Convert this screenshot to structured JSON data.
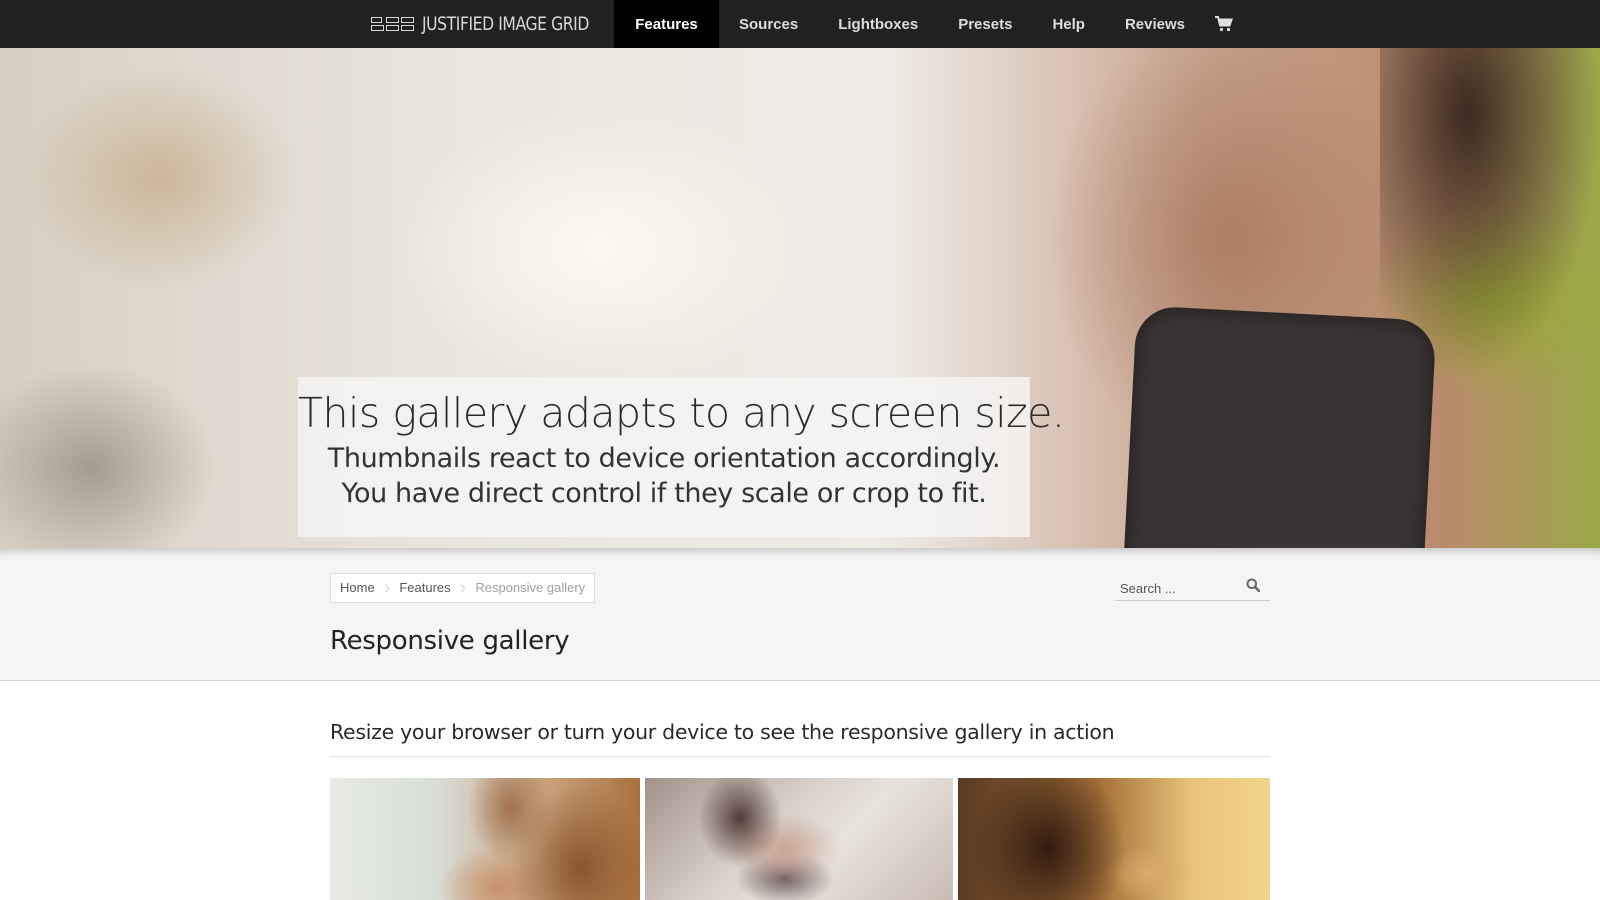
{
  "nav": {
    "logo_text": "JUSTIFIED IMAGE GRID",
    "items": [
      {
        "label": "Features",
        "active": true
      },
      {
        "label": "Sources"
      },
      {
        "label": "Lightboxes"
      },
      {
        "label": "Presets"
      },
      {
        "label": "Help"
      },
      {
        "label": "Reviews"
      }
    ],
    "cart_icon": "shopping-cart-icon"
  },
  "hero": {
    "title": "This gallery adapts to any screen size.",
    "line1": "Thumbnails react to device orientation accordingly.",
    "line2": "You have direct control if they scale or crop to fit."
  },
  "breadcrumb": [
    "Home",
    "Features",
    "Responsive gallery"
  ],
  "search": {
    "placeholder": "Search ...",
    "icon": "search-icon"
  },
  "page_title": "Responsive gallery",
  "section_heading": "Resize your browser or turn your device to see the responsive gallery in action",
  "gallery": {
    "thumbnail_count": 3
  },
  "colors": {
    "nav_bg": "#212121",
    "nav_active_bg": "#000000",
    "strip_bg": "#f5f5f5"
  }
}
